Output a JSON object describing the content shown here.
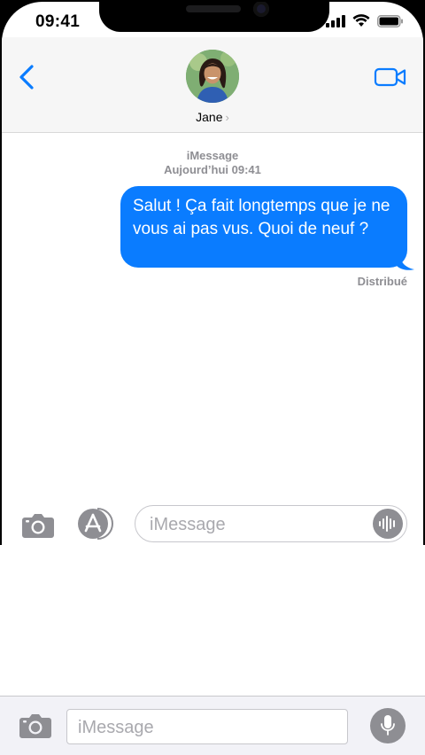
{
  "status_bar": {
    "time": "09:41"
  },
  "header": {
    "contact_name": "Jane",
    "chevron": "›"
  },
  "conversation": {
    "service": "iMessage",
    "timestamp": "Aujourd’hui 09:41",
    "messages": [
      {
        "text": "Salut ! Ça fait longtemps que je ne vous ai pas vus. Quoi de neuf ?",
        "sender": "me",
        "color": "#0a7cff"
      }
    ],
    "delivery_status": "Distribué"
  },
  "input_bar": {
    "placeholder": "iMessage"
  },
  "bottom_bar": {
    "placeholder": "iMessage"
  },
  "icons": {
    "back": "chevron-left-icon",
    "video": "video-camera-icon",
    "camera": "camera-icon",
    "appstore": "app-store-icon",
    "audio": "audio-waveform-icon",
    "mic": "microphone-icon"
  },
  "colors": {
    "accent": "#0a7cff",
    "gray": "#8e8e93"
  }
}
